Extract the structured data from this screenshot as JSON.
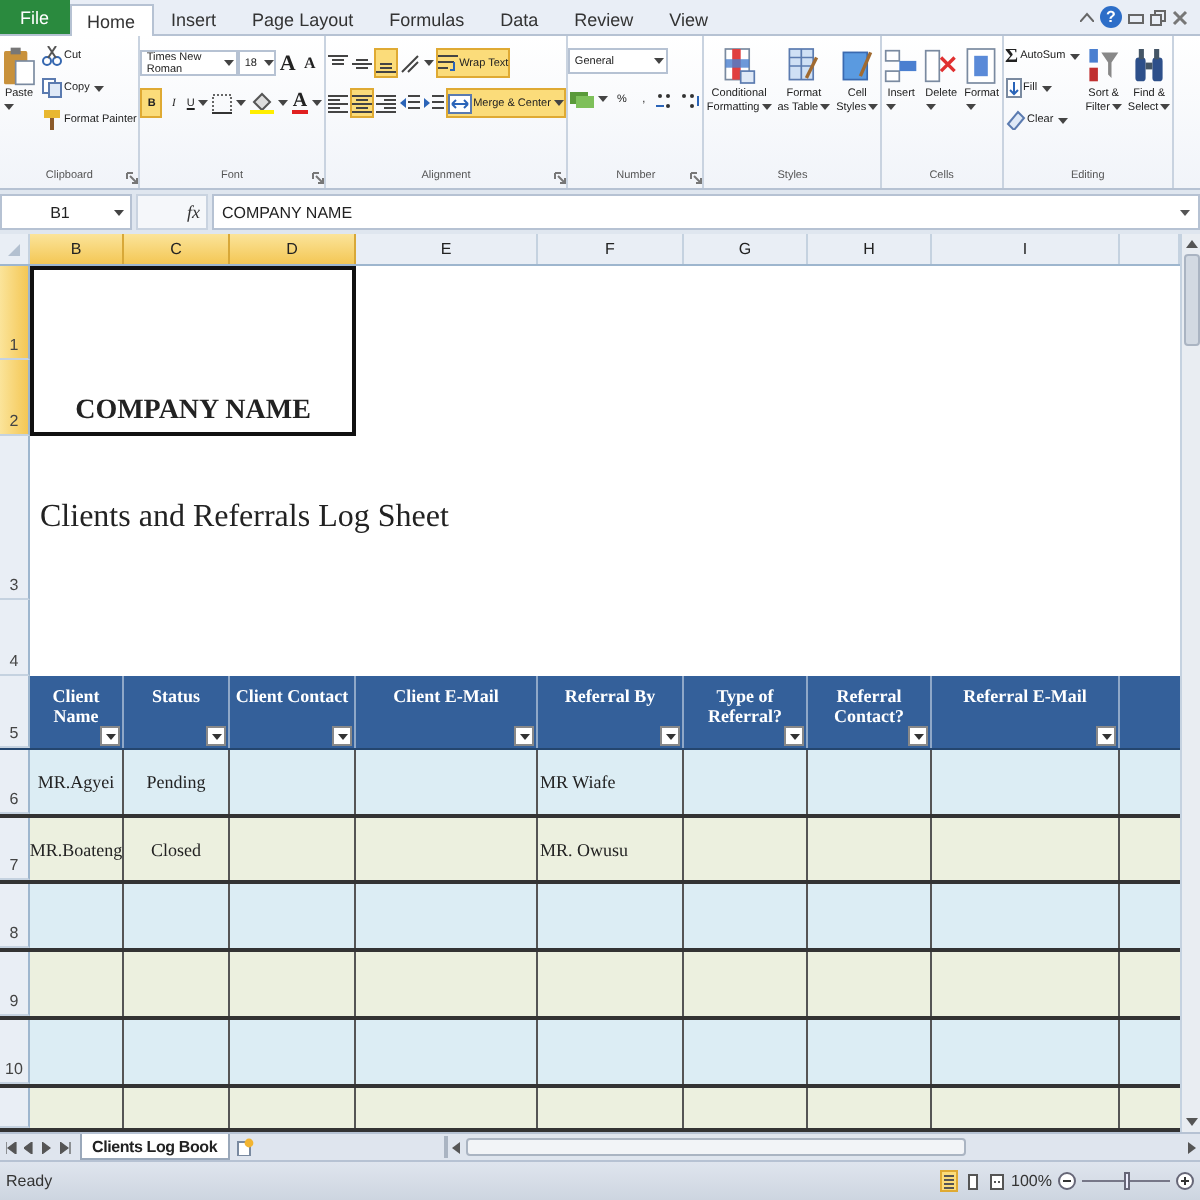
{
  "tabs": [
    {
      "label": "File",
      "kind": "file",
      "selected": false
    },
    {
      "label": "Home",
      "kind": "tab",
      "selected": true
    },
    {
      "label": "Insert",
      "kind": "tab",
      "selected": false
    },
    {
      "label": "Page Layout",
      "kind": "tab",
      "selected": false
    },
    {
      "label": "Formulas",
      "kind": "tab",
      "selected": false
    },
    {
      "label": "Data",
      "kind": "tab",
      "selected": false
    },
    {
      "label": "Review",
      "kind": "tab",
      "selected": false
    },
    {
      "label": "View",
      "kind": "tab",
      "selected": false
    }
  ],
  "help": {
    "label": "?"
  },
  "ribbon": [
    {
      "title": "Clipboard",
      "launcher": true,
      "controls": [
        {
          "kind": "large",
          "label": "Paste",
          "dropdown": true
        },
        {
          "kind": "small",
          "label": "Cut",
          "dropdown": false
        },
        {
          "kind": "small",
          "label": "Copy",
          "dropdown": true
        },
        {
          "kind": "small",
          "label": "Format Painter",
          "dropdown": false
        }
      ]
    },
    {
      "title": "Font",
      "launcher": true,
      "controls": [
        {
          "kind": "combo",
          "value": "Times New Roman"
        },
        {
          "kind": "combo",
          "value": "18"
        },
        {
          "kind": "icon",
          "glyph": "A",
          "dropdown": false
        },
        {
          "kind": "icon",
          "glyph": "A",
          "dropdown": false
        },
        {
          "kind": "toggle",
          "glyph": "B",
          "selected": true,
          "dropdown": false
        },
        {
          "kind": "toggle",
          "glyph": "I",
          "selected": false,
          "dropdown": false
        },
        {
          "kind": "toggle",
          "glyph": "U",
          "selected": false,
          "dropdown": true
        },
        {
          "kind": "icon",
          "dropdown": true
        },
        {
          "kind": "icon",
          "dropdown": true
        },
        {
          "kind": "icon",
          "glyph": "A",
          "dropdown": true
        }
      ]
    },
    {
      "title": "Alignment",
      "launcher": true,
      "controls": [
        {
          "kind": "toggle",
          "selected": false,
          "dropdown": false
        },
        {
          "kind": "toggle",
          "selected": false,
          "dropdown": false
        },
        {
          "kind": "toggle",
          "selected": true,
          "dropdown": false
        },
        {
          "kind": "icon",
          "dropdown": true
        },
        {
          "kind": "toggle",
          "label": "Wrap Text",
          "selected": true,
          "dropdown": false
        },
        {
          "kind": "toggle",
          "selected": false,
          "dropdown": false
        },
        {
          "kind": "toggle",
          "selected": true,
          "dropdown": false
        },
        {
          "kind": "toggle",
          "selected": false,
          "dropdown": false
        },
        {
          "kind": "icon",
          "dropdown": false
        },
        {
          "kind": "icon",
          "dropdown": false
        },
        {
          "kind": "toggle",
          "label": "Merge & Center",
          "selected": true,
          "dropdown": true
        }
      ]
    },
    {
      "title": "Number",
      "launcher": true,
      "controls": [
        {
          "kind": "combo",
          "value": "General"
        },
        {
          "kind": "icon",
          "dropdown": true
        },
        {
          "kind": "icon",
          "glyph": "%",
          "dropdown": false
        },
        {
          "kind": "icon",
          "glyph": ",",
          "dropdown": false
        },
        {
          "kind": "icon",
          "dropdown": false
        },
        {
          "kind": "icon",
          "dropdown": false
        }
      ]
    },
    {
      "title": "Styles",
      "launcher": false,
      "controls": [
        {
          "kind": "large",
          "label": "Conditional\nFormatting",
          "dropdown": true
        },
        {
          "kind": "large",
          "label": "Format\nas Table",
          "dropdown": true
        },
        {
          "kind": "large",
          "label": "Cell\nStyles",
          "dropdown": true
        }
      ]
    },
    {
      "title": "Cells",
      "launcher": false,
      "controls": [
        {
          "kind": "large",
          "label": "Insert",
          "dropdown": true
        },
        {
          "kind": "large",
          "label": "Delete",
          "dropdown": true
        },
        {
          "kind": "large",
          "label": "Format",
          "dropdown": true
        }
      ]
    },
    {
      "title": "Editing",
      "launcher": false,
      "controls": [
        {
          "kind": "small",
          "glyph": "Σ",
          "label": "AutoSum",
          "dropdown": true
        },
        {
          "kind": "small",
          "label": "Fill",
          "dropdown": true
        },
        {
          "kind": "small",
          "label": "Clear",
          "dropdown": true
        },
        {
          "kind": "large",
          "label": "Sort &\nFilter",
          "dropdown": true
        },
        {
          "kind": "large",
          "label": "Find &\nSelect",
          "dropdown": true
        }
      ]
    }
  ],
  "formula_bar": {
    "name_box": "B1",
    "function_label": "fx",
    "content": "COMPANY NAME"
  },
  "sheet": {
    "columns": [
      {
        "letter": "B",
        "selected": true
      },
      {
        "letter": "C",
        "selected": true
      },
      {
        "letter": "D",
        "selected": true
      },
      {
        "letter": "E",
        "selected": false
      },
      {
        "letter": "F",
        "selected": false
      },
      {
        "letter": "G",
        "selected": false
      },
      {
        "letter": "H",
        "selected": false
      },
      {
        "letter": "I",
        "selected": false
      }
    ],
    "rows": [
      {
        "number": "1",
        "selected": true
      },
      {
        "number": "2",
        "selected": true
      },
      {
        "number": "3",
        "selected": false
      },
      {
        "number": "4",
        "selected": false
      },
      {
        "number": "5",
        "selected": false
      },
      {
        "number": "6",
        "selected": false
      },
      {
        "number": "7",
        "selected": false
      },
      {
        "number": "8",
        "selected": false
      },
      {
        "number": "9",
        "selected": false
      },
      {
        "number": "10",
        "selected": false
      }
    ],
    "company_name": "COMPANY NAME",
    "title": "Clients and Referrals Log Sheet",
    "table": {
      "columns": [
        "Client Name",
        "Status",
        "Client Contact",
        "Client E-Mail",
        "Referral By",
        "Type of Referral?",
        "Referral Contact?",
        "Referral E-Mail"
      ],
      "rows": [
        {
          "client_name": "MR.Agyei",
          "status": "Pending",
          "referral_by": "MR Wiafe"
        },
        {
          "client_name": "MR.Boateng",
          "status": "Closed",
          "referral_by": "MR. Owusu"
        }
      ]
    }
  },
  "sheet_tabs": [
    {
      "label": "Clients Log Book",
      "selected": true
    }
  ],
  "status_bar": {
    "text": "Ready",
    "views": [
      {
        "selected": true
      },
      {
        "selected": false
      },
      {
        "selected": false
      }
    ],
    "zoom": {
      "label": "100%",
      "level": 0.5
    }
  }
}
